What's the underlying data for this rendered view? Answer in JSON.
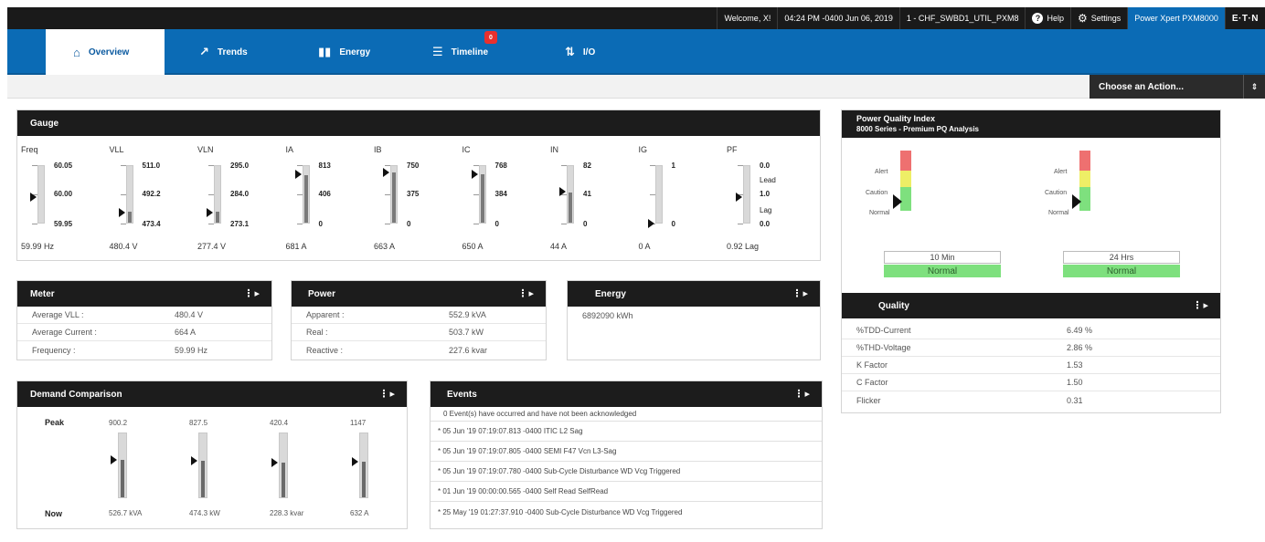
{
  "topbar": {
    "welcome": "Welcome, X!",
    "datetime": "04:24 PM -0400 Jun 06, 2019",
    "device_name": "1 - CHF_SWBD1_UTIL_PXM8",
    "help": "Help",
    "settings": "Settings",
    "product": "Power Xpert PXM8000",
    "logo": "E·T·N"
  },
  "nav": {
    "tabs": [
      {
        "label": "Overview",
        "icon": "home-icon"
      },
      {
        "label": "Trends",
        "icon": "trend-icon"
      },
      {
        "label": "Energy",
        "icon": "bar-chart-icon"
      },
      {
        "label": "Timeline",
        "icon": "list-icon",
        "badge": "0"
      },
      {
        "label": "I/O",
        "icon": "io-arrows-icon"
      }
    ]
  },
  "action": {
    "label": "Choose an Action...",
    "arrow": "⇕"
  },
  "gauge": {
    "title": "Gauge",
    "items": [
      {
        "name": "Freq",
        "max": "60.05",
        "mid": "60.00",
        "min": "59.95",
        "value": "59.99 Hz",
        "level": 0.45,
        "fill": 0.0
      },
      {
        "name": "VLL",
        "max": "511.0",
        "mid": "492.2",
        "min": "473.4",
        "value": "480.4 V",
        "level": 0.19,
        "fill": 0.19
      },
      {
        "name": "VLN",
        "max": "295.0",
        "mid": "284.0",
        "min": "273.1",
        "value": "277.4 V",
        "level": 0.19,
        "fill": 0.19
      },
      {
        "name": "IA",
        "max": "813",
        "mid": "406",
        "min": "0",
        "value": "681 A",
        "level": 0.84,
        "fill": 0.84
      },
      {
        "name": "IB",
        "max": "750",
        "mid": "375",
        "min": "0",
        "value": "663 A",
        "level": 0.88,
        "fill": 0.88
      },
      {
        "name": "IC",
        "max": "768",
        "mid": "384",
        "min": "0",
        "value": "650 A",
        "level": 0.85,
        "fill": 0.85
      },
      {
        "name": "IN",
        "max": "82",
        "mid": "41",
        "min": "0",
        "value": "44 A",
        "level": 0.54,
        "fill": 0.54
      },
      {
        "name": "IG",
        "max": "1",
        "mid": "",
        "min": "0",
        "value": "0 A",
        "level": 0.0,
        "fill": 0.0
      },
      {
        "name": "PF",
        "max": "0.0",
        "lead": "Lead",
        "mid": "1.0",
        "lag": "Lag",
        "min": "0.0",
        "value": "0.92 Lag",
        "level": 0.45,
        "fill": 0.0
      }
    ]
  },
  "meter": {
    "title": "Meter",
    "rows": [
      {
        "label": "Average VLL :",
        "value": "480.4 V"
      },
      {
        "label": "Average Current :",
        "value": "664 A"
      },
      {
        "label": "Frequency :",
        "value": "59.99 Hz"
      }
    ]
  },
  "power": {
    "title": "Power",
    "rows": [
      {
        "label": "Apparent :",
        "value": "552.9 kVA"
      },
      {
        "label": "Real :",
        "value": "503.7 kW"
      },
      {
        "label": "Reactive :",
        "value": "227.6 kvar"
      }
    ]
  },
  "energy": {
    "title": "Energy",
    "value": "6892090 kWh"
  },
  "pqi": {
    "title": "Power Quality Index",
    "subtitle": "8000 Series - Premium PQ Analysis",
    "labels": {
      "alert": "Alert",
      "caution": "Caution",
      "normal": "Normal"
    },
    "windows": [
      {
        "period": "10 Min",
        "status": "Normal"
      },
      {
        "period": "24 Hrs",
        "status": "Normal"
      }
    ],
    "colors": {
      "alert": "#ee7070",
      "caution": "#eeee66",
      "normal": "#7ee07e"
    }
  },
  "quality": {
    "title": "Quality",
    "rows": [
      {
        "label": "%TDD-Current",
        "value": "6.49 %"
      },
      {
        "label": "%THD-Voltage",
        "value": "2.86 %"
      },
      {
        "label": "K Factor",
        "value": "1.53"
      },
      {
        "label": "C Factor",
        "value": "1.50"
      },
      {
        "label": "Flicker",
        "value": "0.31"
      }
    ]
  },
  "demand": {
    "title": "Demand Comparison",
    "peak_label": "Peak",
    "now_label": "Now",
    "items": [
      {
        "peak": "900.2",
        "now": "526.7 kVA",
        "level": 0.58
      },
      {
        "peak": "827.5",
        "now": "474.3 kW",
        "level": 0.57
      },
      {
        "peak": "420.4",
        "now": "228.3 kvar",
        "level": 0.54
      },
      {
        "peak": "1147",
        "now": "632 A",
        "level": 0.55
      }
    ]
  },
  "events": {
    "title": "Events",
    "summary": "0 Event(s) have occurred and have not been acknowledged",
    "items": [
      "* 05 Jun '19 07:19:07.813 -0400 ITIC L2 Sag",
      "* 05 Jun '19 07:19:07.805 -0400 SEMI F47 Vcn L3-Sag",
      "* 05 Jun '19 07:19:07.780 -0400 Sub-Cycle Disturbance WD Vcg Triggered",
      "* 01 Jun '19 00:00:00.565 -0400 Self Read SelfRead",
      "* 25 May '19 01:27:37.910 -0400 Sub-Cycle Disturbance WD Vcg Triggered"
    ]
  },
  "more_icon": "⋮▸"
}
